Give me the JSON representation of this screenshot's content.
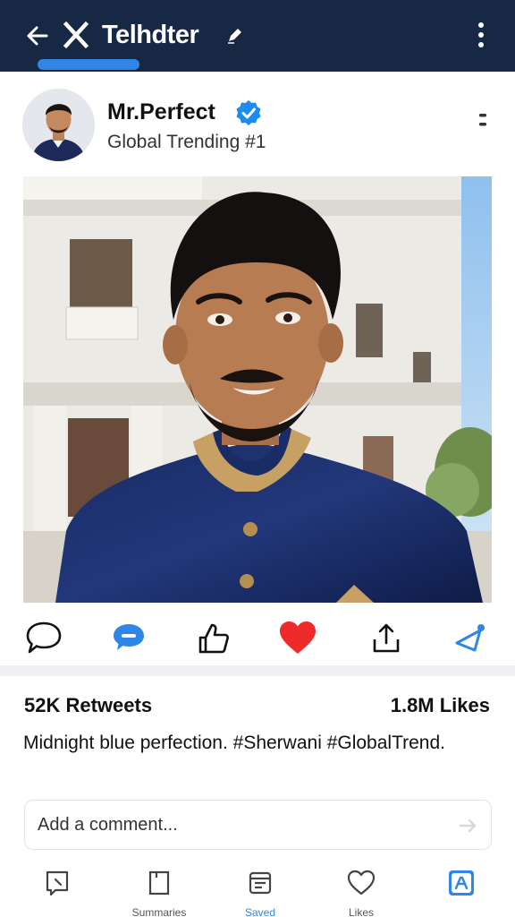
{
  "colors": {
    "topbar": "#172844",
    "accent": "#2f86e6",
    "verified": "#1d8bf0",
    "like": "#ee2a2a",
    "text": "#111111",
    "divider": "#eef0f3"
  },
  "topbar": {
    "title": "Telhdter",
    "icons": [
      "back-arrow-icon",
      "x-logo-icon",
      "pencil-icon",
      "kebab-menu-icon"
    ]
  },
  "post": {
    "author_name": "Mr.Perfect",
    "verified": true,
    "subtitle": "Global Trending #1",
    "icons": [
      "verified-badge-icon",
      "more-options-icon"
    ]
  },
  "actions": {
    "icons": [
      "comment-icon",
      "chat-bubble-icon",
      "thumbs-up-icon",
      "heart-icon",
      "share-icon",
      "send-icon"
    ],
    "liked": true
  },
  "stats": {
    "retweets": "52K Retweets",
    "likes": "1.8M Likes"
  },
  "caption": "Midnight blue perfection. #Sherwani #GlobalTrend.",
  "comment": {
    "placeholder": "Add a comment...",
    "value": ""
  },
  "bottom_nav": {
    "items": [
      {
        "label": "",
        "icon": "home-icon",
        "active": false
      },
      {
        "label": "Summaries",
        "icon": "bookmark-icon",
        "active": false
      },
      {
        "label": "Saved",
        "icon": "feed-icon",
        "active": true
      },
      {
        "label": "Likes",
        "icon": "heart-outline-icon",
        "active": false
      },
      {
        "label": "",
        "icon": "profile-icon",
        "active": false
      }
    ]
  }
}
